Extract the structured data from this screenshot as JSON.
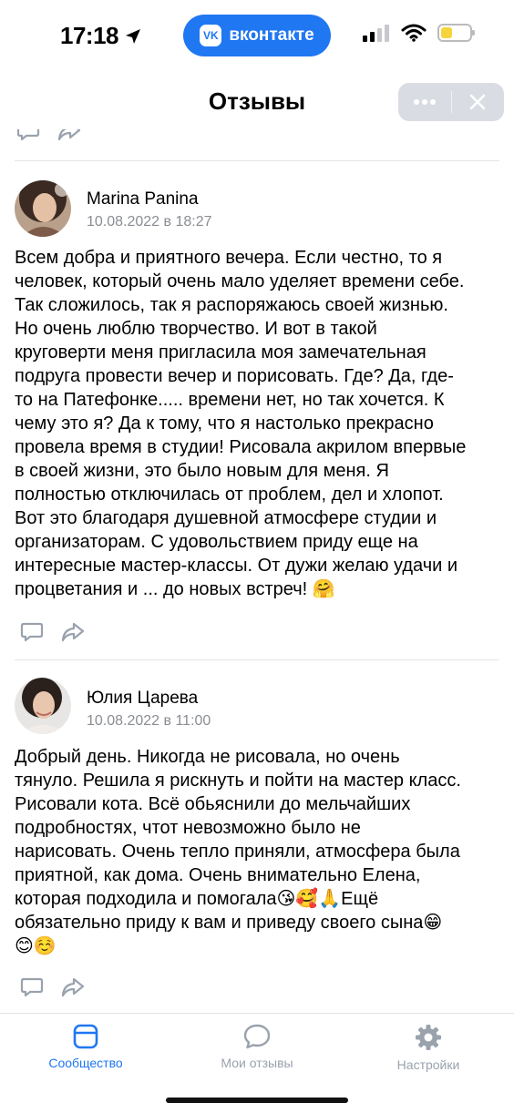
{
  "status_bar": {
    "time": "17:18",
    "app_pill_label": "вконтакте",
    "app_pill_logo": "VK"
  },
  "header": {
    "title": "Отзывы",
    "more_icon": "more-dots-icon",
    "close_icon": "close-icon"
  },
  "reviews": [
    {
      "author": "Marina Panina",
      "date": "10.08.2022 в 18:27",
      "text_lines": [
        "Всем добра и приятного вечера. Если честно, то я",
        "человек, который очень мало уделяет времени себе.",
        "Так сложилось, так я распоряжаюсь своей жизнью.",
        "Но очень люблю творчество. И вот в такой",
        "круговерти меня пригласила моя замечательная",
        "подруга провести вечер и порисовать. Где? Да, где-",
        "то на Патефонке..... времени нет, но так хочется. К",
        "чему это я? Да к тому, что я настолько прекрасно",
        "провела время в студии! Рисовала акрилом впервые",
        "в своей жизни, это было новым для меня. Я",
        "полностью отключилась от проблем, дел и хлопот.",
        "Вот это благодаря душевной атмосфере студии и",
        "организаторам. С удовольствием приду еще на",
        "интересные мастер-классы. От дужи желаю удачи и",
        "процветания и ... до новых встреч! 🤗"
      ]
    },
    {
      "author": "Юлия Царева",
      "date": "10.08.2022 в 11:00",
      "text_lines": [
        "Добрый день. Никогда не рисовала, но очень",
        "тянуло. Решила я рискнуть и пойти на мастер класс.",
        "Рисовали кота. Всё обьяснили до мельчайших",
        "подробностях, чтот невозможно было не",
        "нарисовать. Очень тепло приняли, атмосфера была",
        "приятной, как дома. Очень внимательно Елена,",
        "которая подходила и помогала😘🥰🙏Ещё",
        "обязательно приду к вам и приведу своего сына😁",
        "😊☺️"
      ]
    }
  ],
  "tabs": [
    {
      "label": "Сообщество",
      "icon": "community-icon",
      "active": true
    },
    {
      "label": "Мои отзывы",
      "icon": "chat-bubble-icon",
      "active": false
    },
    {
      "label": "Настройки",
      "icon": "gear-icon",
      "active": false
    }
  ],
  "colors": {
    "accent": "#1f77f2",
    "muted": "#8a8d93",
    "action_icon": "#99a2ad",
    "battery": "#f6d53c"
  }
}
